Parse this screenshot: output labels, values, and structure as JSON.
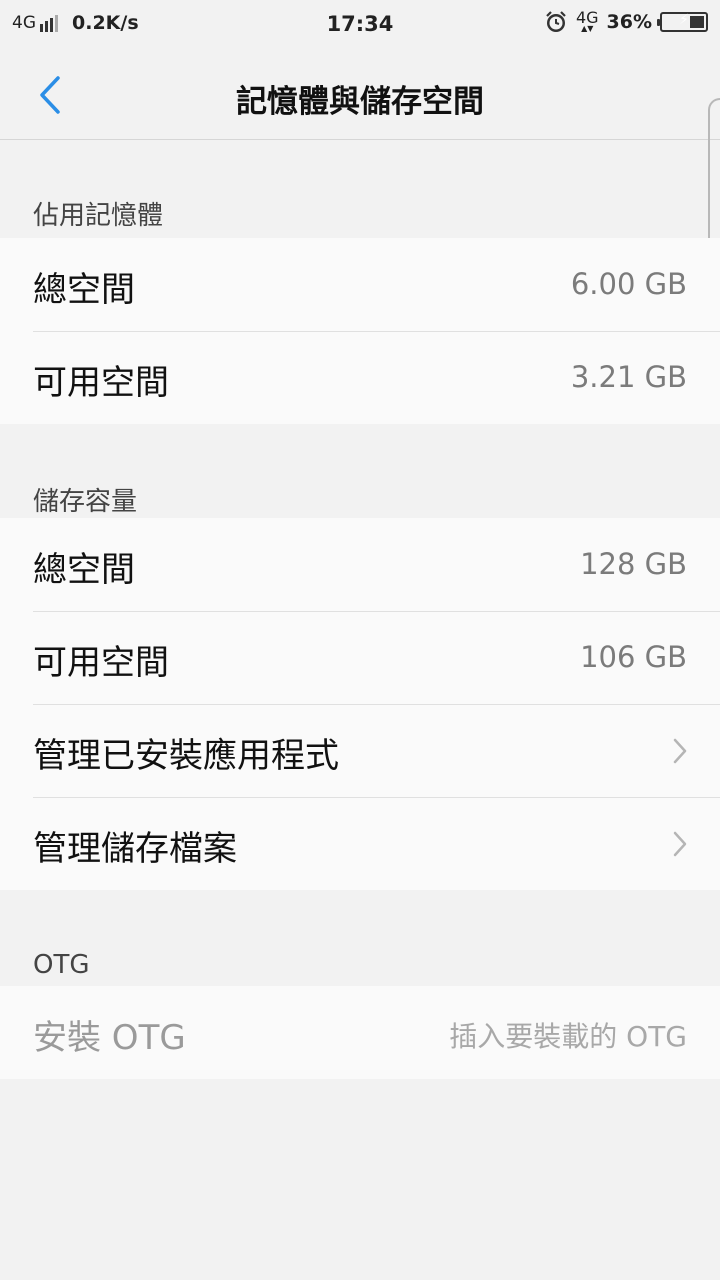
{
  "status_bar": {
    "network_left": "4G",
    "speed": "0.2K/s",
    "time": "17:34",
    "network_right": "4G",
    "battery_percent": "36%",
    "battery_level": 0.36,
    "icons": [
      "signal-icon",
      "alarm-icon",
      "battery-charging-icon"
    ]
  },
  "header": {
    "title": "記憶體與儲存空間",
    "back_icon": "chevron-left-icon",
    "accent": "#2b8ee6"
  },
  "memory": {
    "label": "佔用記憶體",
    "rows": [
      {
        "label": "總空間",
        "value": "6.00 GB"
      },
      {
        "label": "可用空間",
        "value": "3.21 GB"
      }
    ]
  },
  "storage": {
    "label": "儲存容量",
    "rows": [
      {
        "label": "總空間",
        "value": "128 GB"
      },
      {
        "label": "可用空間",
        "value": "106 GB"
      }
    ],
    "links": [
      {
        "label": "管理已安裝應用程式",
        "icon": "chevron-right-icon"
      },
      {
        "label": "管理儲存檔案",
        "icon": "chevron-right-icon"
      }
    ]
  },
  "otg": {
    "label": "OTG",
    "row": {
      "label": "安裝 OTG",
      "value": "插入要裝載的 OTG"
    }
  }
}
